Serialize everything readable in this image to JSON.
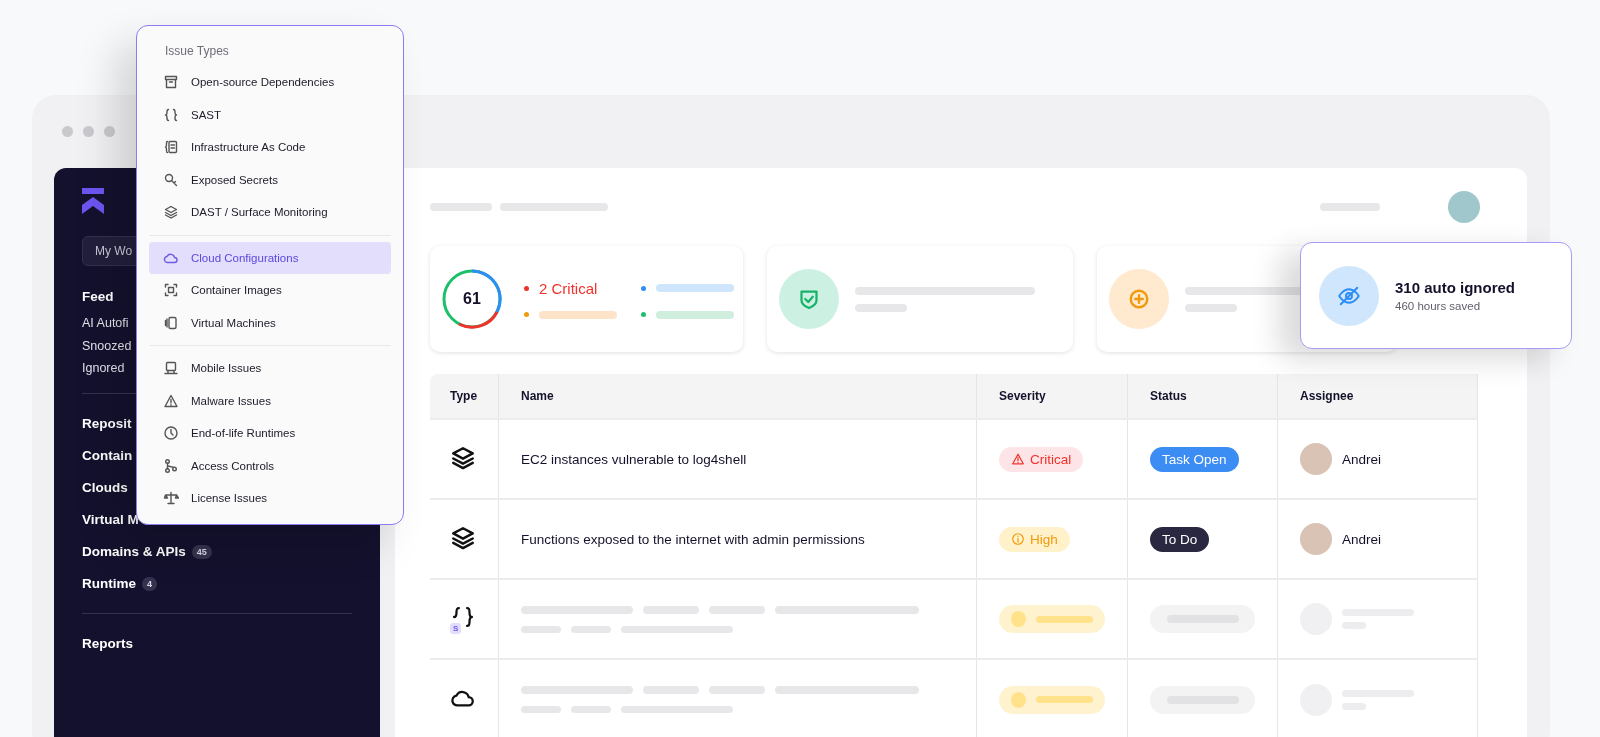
{
  "sidebar": {
    "workspace": "My Wo",
    "items": [
      {
        "kind": "heading",
        "label": "Feed"
      },
      {
        "kind": "sub",
        "label": "AI Autofi"
      },
      {
        "kind": "sub",
        "label": "Snoozed"
      },
      {
        "kind": "sub",
        "label": "Ignored"
      },
      {
        "kind": "divider"
      },
      {
        "kind": "heading",
        "label": "Reposit"
      },
      {
        "kind": "heading",
        "label": "Contain"
      },
      {
        "kind": "heading",
        "label": "Clouds"
      },
      {
        "kind": "heading",
        "label": "Virtual M"
      },
      {
        "kind": "heading",
        "label": "Domains & APIs",
        "count": "45"
      },
      {
        "kind": "heading",
        "label": "Runtime",
        "count": "4"
      },
      {
        "kind": "divider"
      },
      {
        "kind": "heading",
        "label": "Reports"
      }
    ]
  },
  "dropdown": {
    "title": "Issue Types",
    "groups": [
      [
        {
          "label": "Open-source Dependencies",
          "selected": false
        },
        {
          "label": "SAST",
          "selected": false
        },
        {
          "label": "Infrastructure As Code",
          "selected": false
        },
        {
          "label": "Exposed Secrets",
          "selected": false
        },
        {
          "label": "DAST / Surface Monitoring",
          "selected": false
        }
      ],
      [
        {
          "label": "Cloud Configurations",
          "selected": true
        },
        {
          "label": "Container Images",
          "selected": false
        },
        {
          "label": "Virtual Machines",
          "selected": false
        }
      ],
      [
        {
          "label": "Mobile Issues",
          "selected": false
        },
        {
          "label": "Malware Issues",
          "selected": false
        },
        {
          "label": "End-of-life Runtimes",
          "selected": false
        },
        {
          "label": "Access Controls",
          "selected": false
        },
        {
          "label": "License Issues",
          "selected": false
        }
      ]
    ]
  },
  "score": {
    "value": "61",
    "critical": "2 Critical"
  },
  "popup": {
    "title": "310 auto ignored",
    "subtitle": "460 hours saved"
  },
  "table": {
    "columns": [
      "Type",
      "Name",
      "Severity",
      "Status",
      "Assignee"
    ],
    "rows": [
      {
        "kind": "issue",
        "type": {
          "kind": "layers"
        },
        "name": "EC2 instances vulnerable to log4shell",
        "severity": {
          "kind": "critical",
          "label": "Critical"
        },
        "status": {
          "kind": "open",
          "label": "Task Open"
        },
        "assignee": "Andrei"
      },
      {
        "kind": "issue",
        "type": {
          "kind": "layers"
        },
        "name": "Functions exposed to the internet with admin permissions",
        "severity": {
          "kind": "high",
          "label": "High"
        },
        "status": {
          "kind": "todo",
          "label": "To Do"
        },
        "assignee": "Andrei"
      },
      {
        "kind": "loading",
        "type": {
          "kind": "sast",
          "badge": "S"
        }
      },
      {
        "kind": "loading",
        "type": {
          "kind": "cloud"
        }
      }
    ]
  }
}
